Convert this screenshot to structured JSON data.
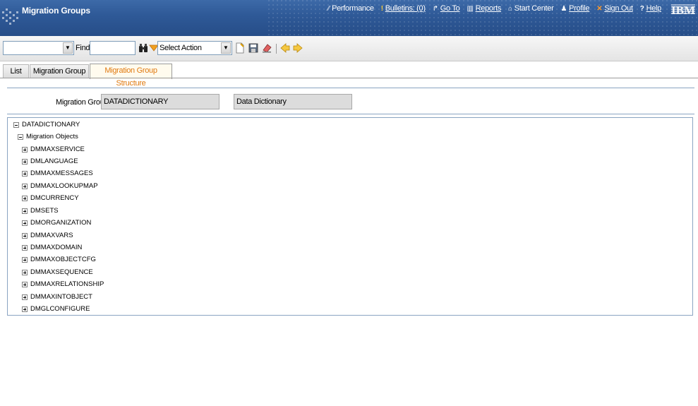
{
  "header": {
    "title": "Migration Groups",
    "nav": [
      {
        "icon": "performance-icon",
        "label": "Performance"
      },
      {
        "icon": "bulletins-icon",
        "label": "Bulletins: (0)"
      },
      {
        "icon": "goto-icon",
        "label": "Go To"
      },
      {
        "icon": "reports-icon",
        "label": "Reports"
      },
      {
        "icon": "start-center-icon",
        "label": "Start Center"
      },
      {
        "icon": "profile-icon",
        "label": "Profile"
      },
      {
        "icon": "sign-out-icon",
        "label": "Sign Out"
      },
      {
        "icon": "help-icon",
        "label": "Help"
      }
    ],
    "brand": "IBM"
  },
  "toolbar": {
    "query_value": "",
    "find_label": "Find:",
    "find_value": "",
    "action_select": "Select Action"
  },
  "tabs": [
    {
      "label": "List"
    },
    {
      "label": "Migration Group"
    },
    {
      "label": "Migration Group Structure"
    }
  ],
  "form": {
    "migration_group_label": "Migration Group",
    "migration_group_value": "DATADICTIONARY",
    "description_value": "Data Dictionary"
  },
  "tree": {
    "root": "DATADICTIONARY",
    "folder": "Migration Objects",
    "items": [
      "DMMAXSERVICE",
      "DMLANGUAGE",
      "DMMAXMESSAGES",
      "DMMAXLOOKUPMAP",
      "DMCURRENCY",
      "DMSETS",
      "DMORGANIZATION",
      "DMMAXVARS",
      "DMMAXDOMAIN",
      "DMMAXOBJECTCFG",
      "DMMAXSEQUENCE",
      "DMMAXRELATIONSHIP",
      "DMMAXINTOBJECT",
      "DMGLCONFIGURE"
    ]
  },
  "colors": {
    "header_blue": "#2f5a98",
    "active_tab_text": "#e07a10",
    "field_bg": "#dcdcdc"
  }
}
